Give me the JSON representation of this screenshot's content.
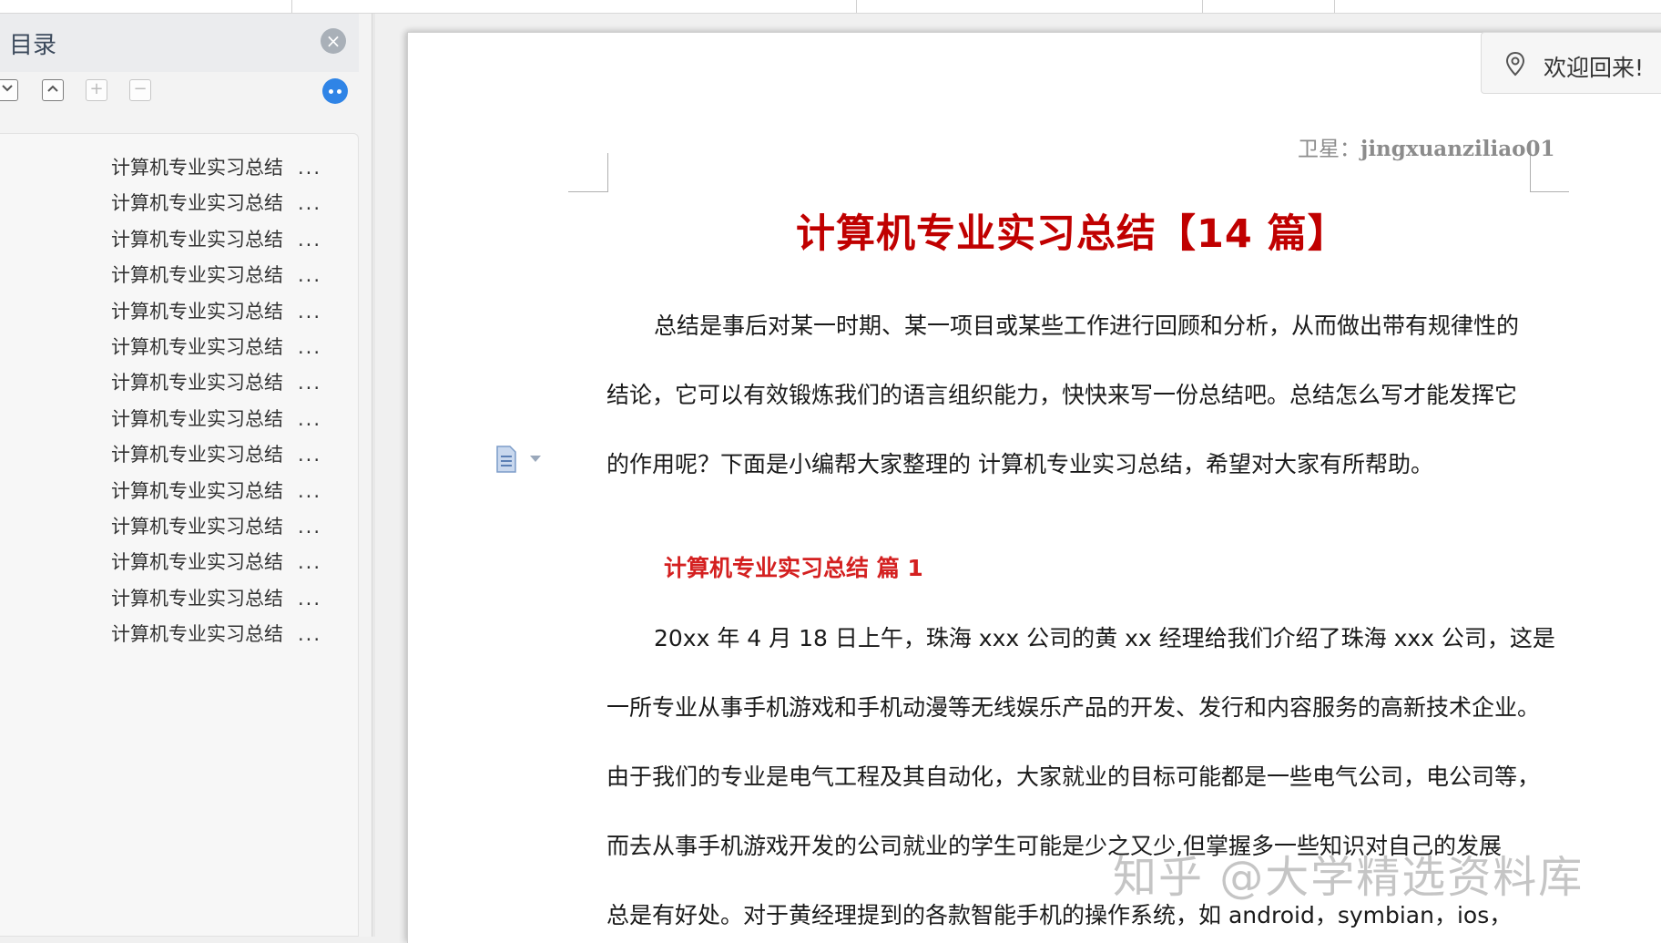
{
  "toc": {
    "title": "目录",
    "items": [
      {
        "label": "计算机专业实习总结",
        "ellipsis": "..."
      },
      {
        "label": "计算机专业实习总结",
        "ellipsis": "..."
      },
      {
        "label": "计算机专业实习总结",
        "ellipsis": "..."
      },
      {
        "label": "计算机专业实习总结",
        "ellipsis": "..."
      },
      {
        "label": "计算机专业实习总结",
        "ellipsis": "..."
      },
      {
        "label": "计算机专业实习总结",
        "ellipsis": "..."
      },
      {
        "label": "计算机专业实习总结",
        "ellipsis": "..."
      },
      {
        "label": "计算机专业实习总结",
        "ellipsis": "..."
      },
      {
        "label": "计算机专业实习总结",
        "ellipsis": "..."
      },
      {
        "label": "计算机专业实习总结",
        "ellipsis": "..."
      },
      {
        "label": "计算机专业实习总结",
        "ellipsis": "..."
      },
      {
        "label": "计算机专业实习总结",
        "ellipsis": "..."
      },
      {
        "label": "计算机专业实习总结",
        "ellipsis": "..."
      },
      {
        "label": "计算机专业实习总结",
        "ellipsis": "..."
      }
    ]
  },
  "welcome": {
    "text": "欢迎回来!"
  },
  "document": {
    "header_label": "卫星：",
    "header_id": "jingxuanziliao01",
    "title": "计算机专业实习总结【14 篇】",
    "intro_lines": [
      "总结是事后对某一时期、某一项目或某些工作进行回顾和分析，从而做出带有规律性的",
      "结论，它可以有效锻炼我们的语言组织能力，快快来写一份总结吧。总结怎么写才能发挥它",
      "的作用呢？下面是小编帮大家整理的 计算机专业实习总结，希望对大家有所帮助。"
    ],
    "section_title": "计算机专业实习总结  篇 1",
    "body_lines": [
      "20xx 年 4 月 18 日上午，珠海 xxx 公司的黄 xx 经理给我们介绍了珠海 xxx 公司，这是",
      "一所专业从事手机游戏和手机动漫等无线娱乐产品的开发、发行和内容服务的高新技术企业。",
      "由于我们的专业是电气工程及其自动化，大家就业的目标可能都是一些电气公司，电公司等，",
      "而去从事手机游戏开发的公司就业的学生可能是少之又少,但掌握多一些知识对自己的发展",
      "总是有好处。对于黄经理提到的各款智能手机的操作系统，如 android，symbian，ios，"
    ]
  },
  "watermark": "知乎 @大学精选资料库",
  "colors": {
    "title_red": "#c00000",
    "section_red": "#d42020",
    "accent_blue": "#2f84e6"
  }
}
